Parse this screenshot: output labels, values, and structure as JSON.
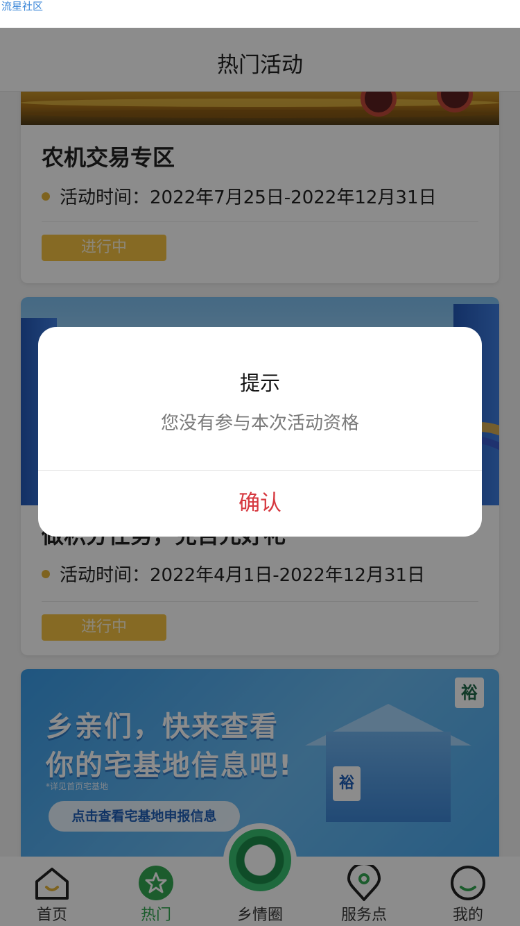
{
  "status": {
    "app_label": "流星社区"
  },
  "header": {
    "title": "热门活动"
  },
  "activities": [
    {
      "title": "农机交易专区",
      "time": "活动时间：2022年7月25日-2022年12月31日",
      "status": "进行中"
    },
    {
      "title": "做积分任务，兑百元好礼",
      "time": "活动时间：2022年4月1日-2022年12月31日",
      "status": "进行中"
    }
  ],
  "promo": {
    "line1": "乡亲们，快来查看",
    "line2": "你的宅基地信息吧!",
    "note": "*详见首页宅基地",
    "button": "点击查看宅基地申报信息",
    "logo_char": "裕",
    "house_char": "裕"
  },
  "dialog": {
    "title": "提示",
    "message": "您没有参与本次活动资格",
    "confirm": "确认"
  },
  "tabbar": {
    "items": [
      {
        "label": "首页",
        "icon": "home-icon",
        "active": false
      },
      {
        "label": "热门",
        "icon": "hot-flower-icon",
        "active": true
      },
      {
        "label": "乡情圈",
        "icon": "circle-icon",
        "active": false
      },
      {
        "label": "服务点",
        "icon": "location-pin-icon",
        "active": false
      },
      {
        "label": "我的",
        "icon": "profile-icon",
        "active": false
      }
    ]
  },
  "colors": {
    "accent": "#34a853",
    "badge": "#f5c242",
    "confirm": "#d6383f",
    "dot": "#e5b53a"
  }
}
